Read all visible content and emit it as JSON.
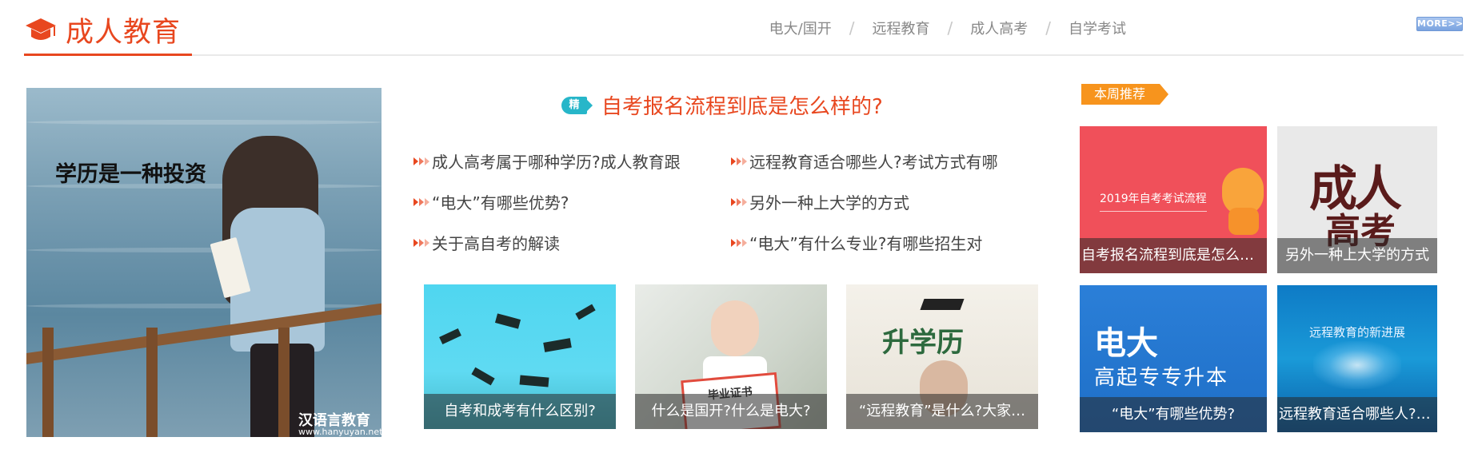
{
  "header": {
    "title": "成人教育",
    "nav": [
      "电大/国开",
      "远程教育",
      "成人高考",
      "自学考试"
    ],
    "separator": "/",
    "more_label": "MORE>>"
  },
  "hero": {
    "overlay_text": "学历是一种投资",
    "logo_text": "汉语言教育",
    "url_text": "www.hanyuyan.net"
  },
  "featured": {
    "badge": "精",
    "title": "自考报名流程到底是怎么样的?"
  },
  "news": [
    "成人高考属于哪种学历?成人教育跟",
    "远程教育适合哪些人?考试方式有哪",
    "“电大”有哪些优势?",
    "另外一种上大学的方式",
    "关于高自考的解读",
    "“电大”有什么专业?有哪些招生对"
  ],
  "thumbs": [
    {
      "caption": "自考和成考有什么区别?"
    },
    {
      "caption": "什么是国开?什么是电大?",
      "image_text": "毕业证书"
    },
    {
      "caption": "“远程教育”是什么?大家…",
      "image_text": "升学历"
    }
  ],
  "recommend": {
    "tag": "本周推荐",
    "items": [
      {
        "caption": "自考报名流程到底是怎么样…",
        "image_text": "2019年自考考试流程"
      },
      {
        "caption": "另外一种上大学的方式",
        "image_text_1": "成人",
        "image_text_2": "高考"
      },
      {
        "caption": "“电大”有哪些优势?",
        "image_title": "电大",
        "image_sub": "高起专专升本"
      },
      {
        "caption": "远程教育适合哪些人?考试方",
        "image_text": "远程教育的新进展"
      }
    ]
  },
  "colors": {
    "accent": "#e8471f",
    "badge": "#27b6c9",
    "recommend_tag": "#f7941d"
  }
}
